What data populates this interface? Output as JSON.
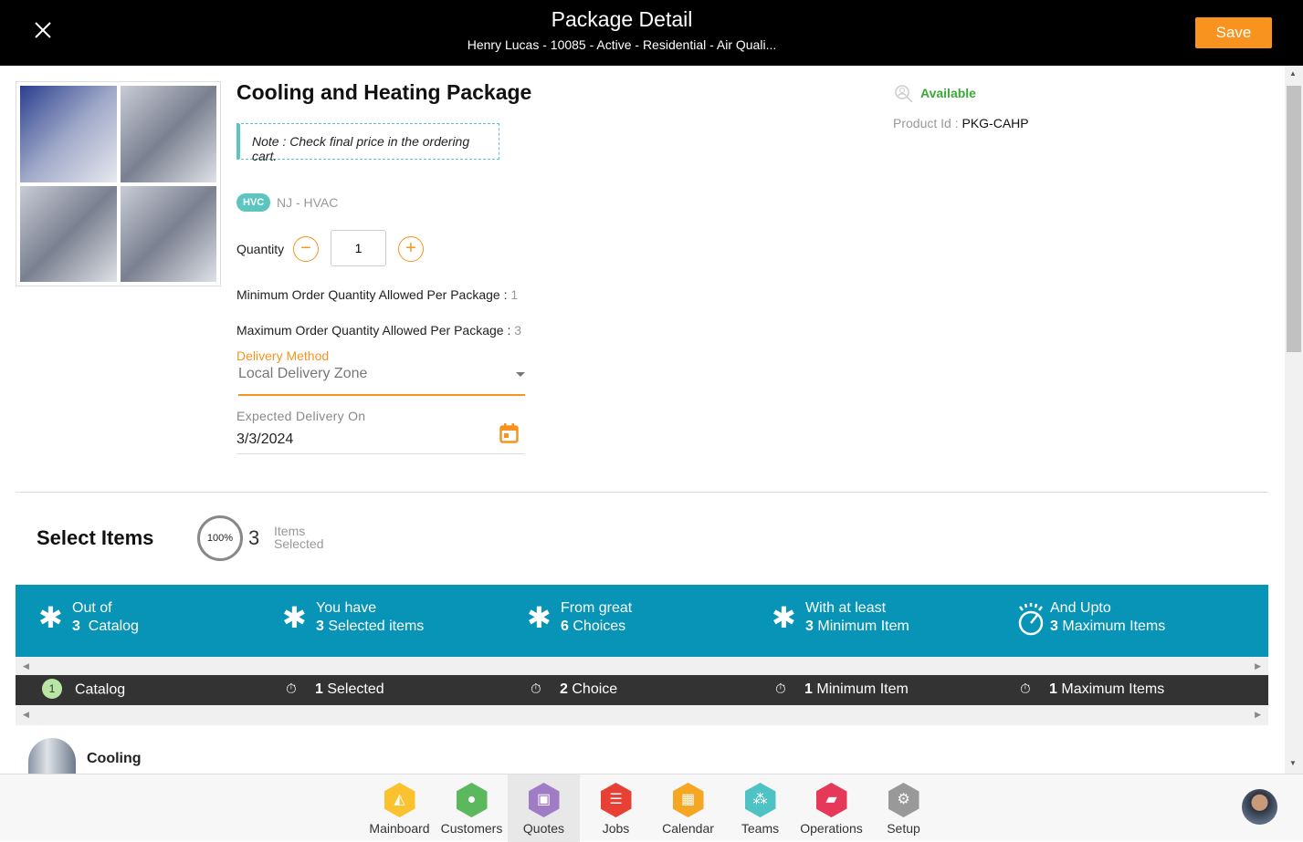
{
  "header": {
    "title": "Package Detail",
    "subtitle": "Henry Lucas - 10085 - Active - Residential - Air Quali...",
    "save_label": "Save"
  },
  "product": {
    "title": "Cooling and Heating Package",
    "note": "Note : Check final price in the ordering cart.",
    "badge": "HVC",
    "category": "NJ - HVAC",
    "availability": "Available",
    "product_id_label": "Product Id :",
    "product_id": "PKG-CAHP"
  },
  "quantity": {
    "label": "Quantity",
    "value": "1",
    "min_label": "Minimum Order Quantity Allowed Per Package :",
    "min_value": "1",
    "max_label": "Maximum Order Quantity Allowed Per Package :",
    "max_value": "3"
  },
  "delivery": {
    "method_label": "Delivery Method",
    "method_value": "Local Delivery Zone",
    "date_label": "Expected Delivery On",
    "date_value": "3/3/2024"
  },
  "select_items": {
    "title": "Select Items",
    "progress": "100%",
    "count": "3",
    "label1": "Items",
    "label2": "Selected"
  },
  "banner": [
    {
      "line1": "Out of",
      "num": "3",
      "text": "Catalog",
      "icon": "asterisk-icon"
    },
    {
      "line1": "You have",
      "num": "3",
      "text": "Selected items",
      "icon": "asterisk-icon"
    },
    {
      "line1": "From great",
      "num": "6",
      "text": "Choices",
      "icon": "asterisk-icon"
    },
    {
      "line1": "With at least",
      "num": "3",
      "text": "Minimum Item",
      "icon": "asterisk-icon"
    },
    {
      "line1": "And Upto",
      "num": "3",
      "text": "Maximum Items",
      "icon": "timer-icon"
    }
  ],
  "catalog_row": {
    "index": "1",
    "name": "Catalog",
    "cells": [
      {
        "num": "1",
        "text": "Selected"
      },
      {
        "num": "2",
        "text": "Choice"
      },
      {
        "num": "1",
        "text": "Minimum Item"
      },
      {
        "num": "1",
        "text": "Maximum Items"
      }
    ]
  },
  "catalog_item": {
    "name": "Cooling"
  },
  "nav": [
    {
      "label": "Mainboard",
      "color": "#f9c22e"
    },
    {
      "label": "Customers",
      "color": "#5cb85c"
    },
    {
      "label": "Quotes",
      "color": "#a07cc5",
      "active": true
    },
    {
      "label": "Jobs",
      "color": "#e94035"
    },
    {
      "label": "Calendar",
      "color": "#f5a623"
    },
    {
      "label": "Teams",
      "color": "#4fc3c4"
    },
    {
      "label": "Operations",
      "color": "#e6395a"
    },
    {
      "label": "Setup",
      "color": "#999999"
    }
  ],
  "colors": {
    "accent": "#f7931e",
    "banner": "#0894b6",
    "available": "#3aa935",
    "teal": "#5cc5c0"
  }
}
